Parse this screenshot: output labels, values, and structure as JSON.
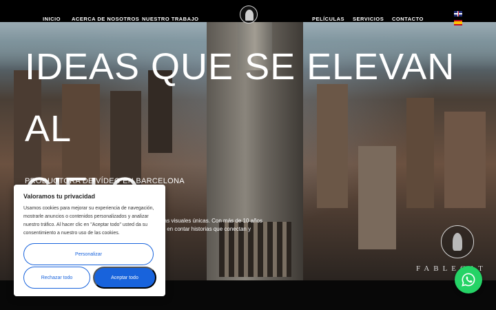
{
  "nav": {
    "left": [
      "INICIO",
      "ACERCA DE NOSOTROS",
      "NUESTRO TRABAJO"
    ],
    "right": [
      "PELÍCULAS",
      "SERVICIOS",
      "CONTACTO"
    ]
  },
  "languages": [
    {
      "code": "en",
      "icon": "uk-flag-icon"
    },
    {
      "code": "es",
      "icon": "spain-flag-icon"
    }
  ],
  "hero": {
    "headline_line1": "IDEAS QUE SE ELEVAN AL",
    "headline_line2": "CIELO",
    "subtitle": "PRODUCTORA DE VÍDEO EN BARCELONA",
    "body_line1": "ias visuales únicas. Con más de 10 años",
    "body_line2": "s en contar historias que conectan y"
  },
  "brand": {
    "logo_icon": "fablecat-logo-icon",
    "wordmark_partial": "FABLECAT"
  },
  "whatsapp": {
    "icon": "whatsapp-icon",
    "color": "#25d366"
  },
  "cookie_banner": {
    "title": "Valoramos tu privacidad",
    "text": "Usamos cookies para mejorar su experiencia de navegación, mostrarle anuncios o contenidos personalizados y analizar nuestro tráfico. Al hacer clic en \"Aceptar todo\" usted da su consentimiento a nuestro uso de las cookies.",
    "customize_label": "Personalizar",
    "reject_label": "Rechazar todo",
    "accept_label": "Aceptar todo",
    "accent_color": "#1863dc"
  }
}
